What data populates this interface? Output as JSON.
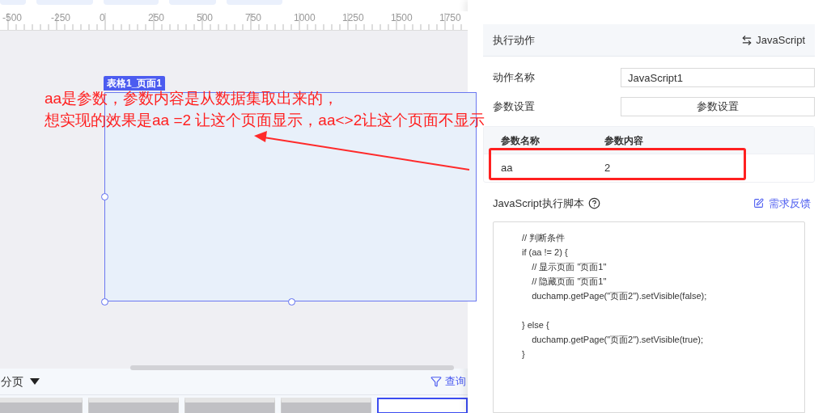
{
  "ruler": {
    "labels": [
      "-500",
      "-250",
      "0",
      "250",
      "500",
      "750",
      "1000",
      "1250",
      "1500",
      "1750"
    ]
  },
  "canvas": {
    "component_label": "表格1_页面1"
  },
  "annotation": {
    "lines": [
      "aa是参数，参数内容是从数据集取出来的，",
      "想实现的效果是aa =2 让这个页面显示，aa<>2让这个页面不显示"
    ]
  },
  "bottom_bar": {
    "pages_label": "分页",
    "query_label": "查询"
  },
  "page_thumbnails": [
    {
      "selected": false
    },
    {
      "selected": false
    },
    {
      "selected": false
    },
    {
      "selected": false
    },
    {
      "selected": true
    }
  ],
  "panel": {
    "header": {
      "title": "执行动作",
      "action_type": "JavaScript"
    },
    "fields": [
      {
        "kind": "input",
        "label": "动作名称",
        "value": "JavaScript1"
      },
      {
        "kind": "button",
        "label": "参数设置",
        "button": "参数设置"
      }
    ],
    "params_table": {
      "columns": [
        "参数名称",
        "参数内容"
      ],
      "rows": [
        [
          "aa",
          "2"
        ]
      ]
    },
    "script_label": "JavaScript执行脚本",
    "feedback_link": "需求反馈",
    "code": [
      {
        "kind": "text",
        "text": "// 判断条件"
      },
      {
        "kind": "text",
        "text": "if (aa != 2) {"
      },
      {
        "kind": "text",
        "text": "    // 显示页面 \"页面1\""
      },
      {
        "kind": "text",
        "text": "    // 隐藏页面 \"页面1\""
      },
      {
        "kind": "text",
        "text": "    duchamp.getPage(\"页面2\").setVisible(false);"
      },
      {
        "kind": "blank"
      },
      {
        "kind": "text",
        "text": "} else {"
      },
      {
        "kind": "text",
        "text": "    duchamp.getPage(\"页面2\").setVisible(true);"
      },
      {
        "kind": "text",
        "text": "}"
      }
    ]
  }
}
